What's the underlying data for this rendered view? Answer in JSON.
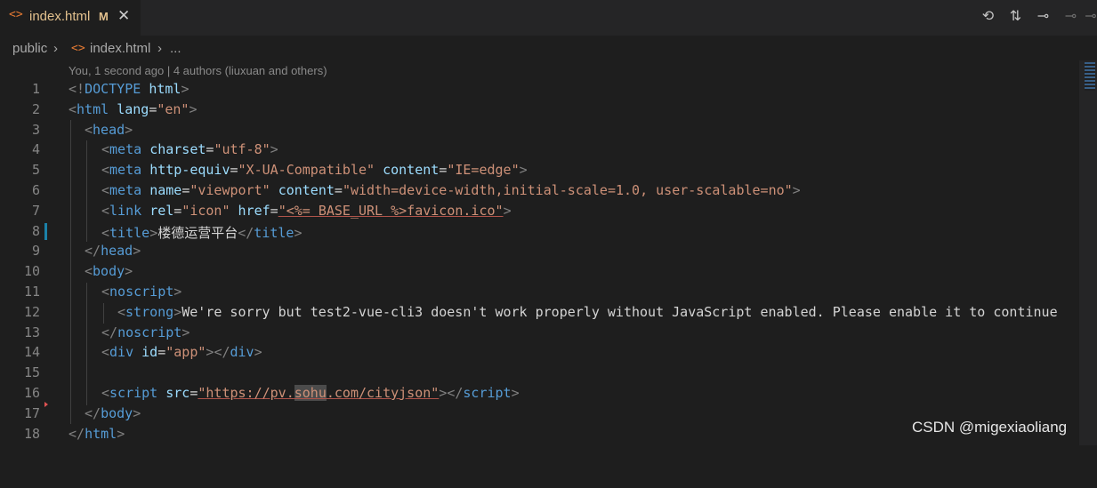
{
  "tab": {
    "icon": "html-file-icon",
    "title": "index.html",
    "modified": "M",
    "close": "✕"
  },
  "breadcrumb": {
    "folder": "public",
    "file": "index.html",
    "more": "..."
  },
  "blame": "You, 1 second ago | 4 authors (liuxuan and others)",
  "code": {
    "lines": [
      "1",
      "2",
      "3",
      "4",
      "5",
      "6",
      "7",
      "8",
      "9",
      "10",
      "11",
      "12",
      "13",
      "14",
      "15",
      "16",
      "17",
      "18"
    ],
    "l1": [
      "<!",
      "DOCTYPE",
      " ",
      "html",
      ">"
    ],
    "l2": [
      "<",
      "html",
      " ",
      "lang",
      "=",
      "\"en\"",
      ">"
    ],
    "l3": [
      "<",
      "head",
      ">"
    ],
    "l4": [
      "<",
      "meta",
      " ",
      "charset",
      "=",
      "\"utf-8\"",
      ">"
    ],
    "l5": [
      "<",
      "meta",
      " ",
      "http-equiv",
      "=",
      "\"X-UA-Compatible\"",
      " ",
      "content",
      "=",
      "\"IE=edge\"",
      ">"
    ],
    "l6": [
      "<",
      "meta",
      " ",
      "name",
      "=",
      "\"viewport\"",
      " ",
      "content",
      "=",
      "\"width=device-width,initial-scale=1.0, user-scalable=no\"",
      ">"
    ],
    "l7": [
      "<",
      "link",
      " ",
      "rel",
      "=",
      "\"icon\"",
      " ",
      "href",
      "=",
      "\"<%= BASE_URL %>favicon.ico\"",
      ">"
    ],
    "l8": [
      "<",
      "title",
      ">",
      "楼德运营平台",
      "</",
      "title",
      ">"
    ],
    "l9": [
      "</",
      "head",
      ">"
    ],
    "l10": [
      "<",
      "body",
      ">"
    ],
    "l11": [
      "<",
      "noscript",
      ">"
    ],
    "l12": [
      "<",
      "strong",
      ">",
      "We're sorry but test2-vue-cli3 doesn't work properly without JavaScript enabled. Please enable it to continue"
    ],
    "l13": [
      "</",
      "noscript",
      ">"
    ],
    "l14": [
      "<",
      "div",
      " ",
      "id",
      "=",
      "\"app\"",
      ">",
      "</",
      "div",
      ">"
    ],
    "l16": [
      "<",
      "script",
      " ",
      "src",
      "=",
      "\"https://pv.",
      "sohu",
      ".com/cityjson\"",
      ">",
      "</",
      "script",
      ">"
    ],
    "l17": [
      "</",
      "body",
      ">"
    ],
    "l18": [
      "</",
      "html",
      ">"
    ]
  },
  "watermark": "CSDN @migexiaoliang",
  "colors": {
    "tag": "#569cd6",
    "attr": "#9cdcfe",
    "string": "#ce9178",
    "punct": "#808080",
    "modified": "#e2c08d"
  }
}
